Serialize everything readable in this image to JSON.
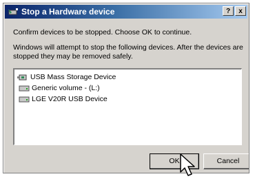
{
  "window": {
    "title": "Stop a Hardware device",
    "help_label": "?",
    "close_label": "x"
  },
  "content": {
    "confirm_text": "Confirm devices to be stopped. Choose OK to continue.",
    "info_text": "Windows will attempt to stop the following devices. After the devices are stopped they may be removed safely."
  },
  "device_list": [
    {
      "label": "USB Mass Storage Device",
      "icon": "usb-device-icon"
    },
    {
      "label": "Generic volume - (L:)",
      "icon": "drive-icon"
    },
    {
      "label": "LGE V20R USB Device",
      "icon": "drive-icon"
    }
  ],
  "buttons": {
    "ok_label": "OK",
    "cancel_label": "Cancel"
  },
  "colors": {
    "dialog_bg": "#d6d3ce",
    "titlebar_start": "#0a246a",
    "titlebar_end": "#a6caf0"
  }
}
